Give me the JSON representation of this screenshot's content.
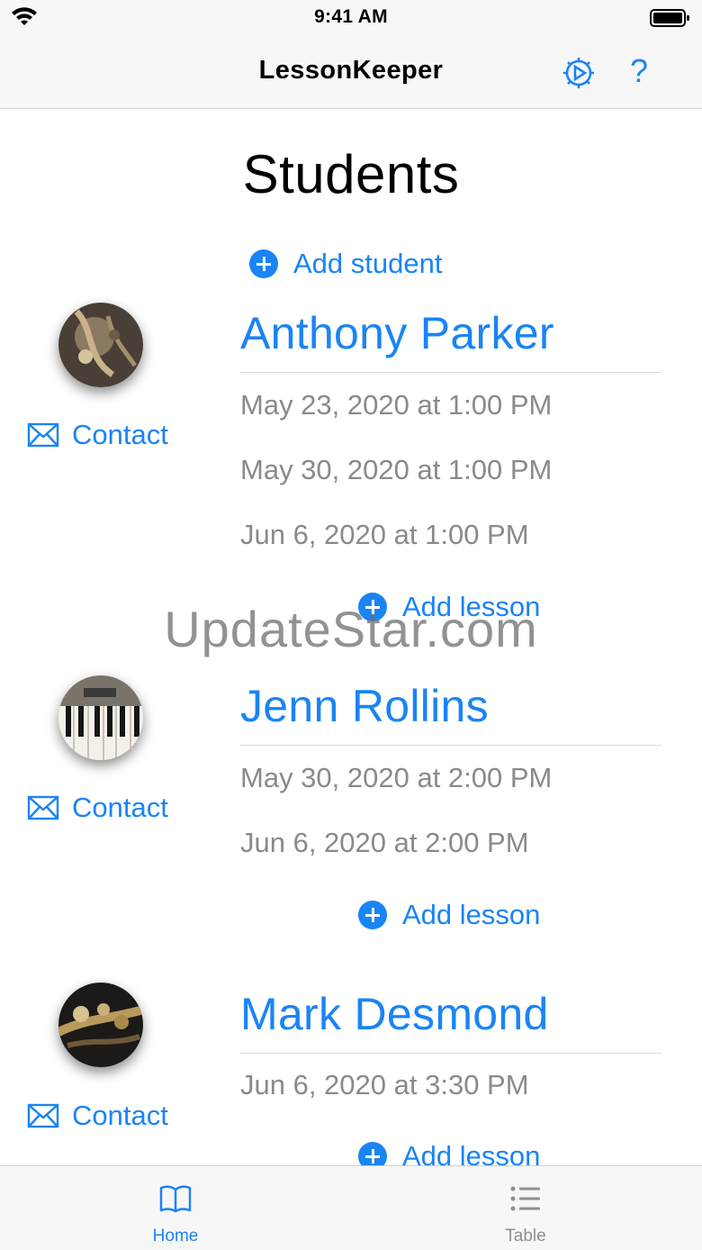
{
  "status_bar": {
    "time": "9:41 AM"
  },
  "nav": {
    "title": "LessonKeeper",
    "help_label": "?"
  },
  "page": {
    "title": "Students",
    "add_student_label": "Add student"
  },
  "students": [
    {
      "name": "Anthony Parker",
      "contact_label": "Contact",
      "lessons": [
        "May 23, 2020 at 1:00 PM",
        "May 30, 2020 at 1:00 PM",
        "Jun 6, 2020 at 1:00 PM"
      ],
      "add_lesson_label": "Add lesson"
    },
    {
      "name": "Jenn Rollins",
      "contact_label": "Contact",
      "lessons": [
        "May 30, 2020 at 2:00 PM",
        "Jun 6, 2020 at 2:00 PM"
      ],
      "add_lesson_label": "Add lesson"
    },
    {
      "name": "Mark Desmond",
      "contact_label": "Contact",
      "lessons": [
        "Jun 6, 2020 at 3:30 PM"
      ],
      "add_lesson_label": "Add lesson"
    }
  ],
  "watermark": "UpdateStar.com",
  "tabs": [
    {
      "label": "Home",
      "icon": "book-icon",
      "selected": true
    },
    {
      "label": "Table",
      "icon": "list-icon",
      "selected": false
    }
  ],
  "colors": {
    "accent": "#1a84f5",
    "secondary_text": "#8a8a8e",
    "bar_background": "#f7f7f7"
  }
}
